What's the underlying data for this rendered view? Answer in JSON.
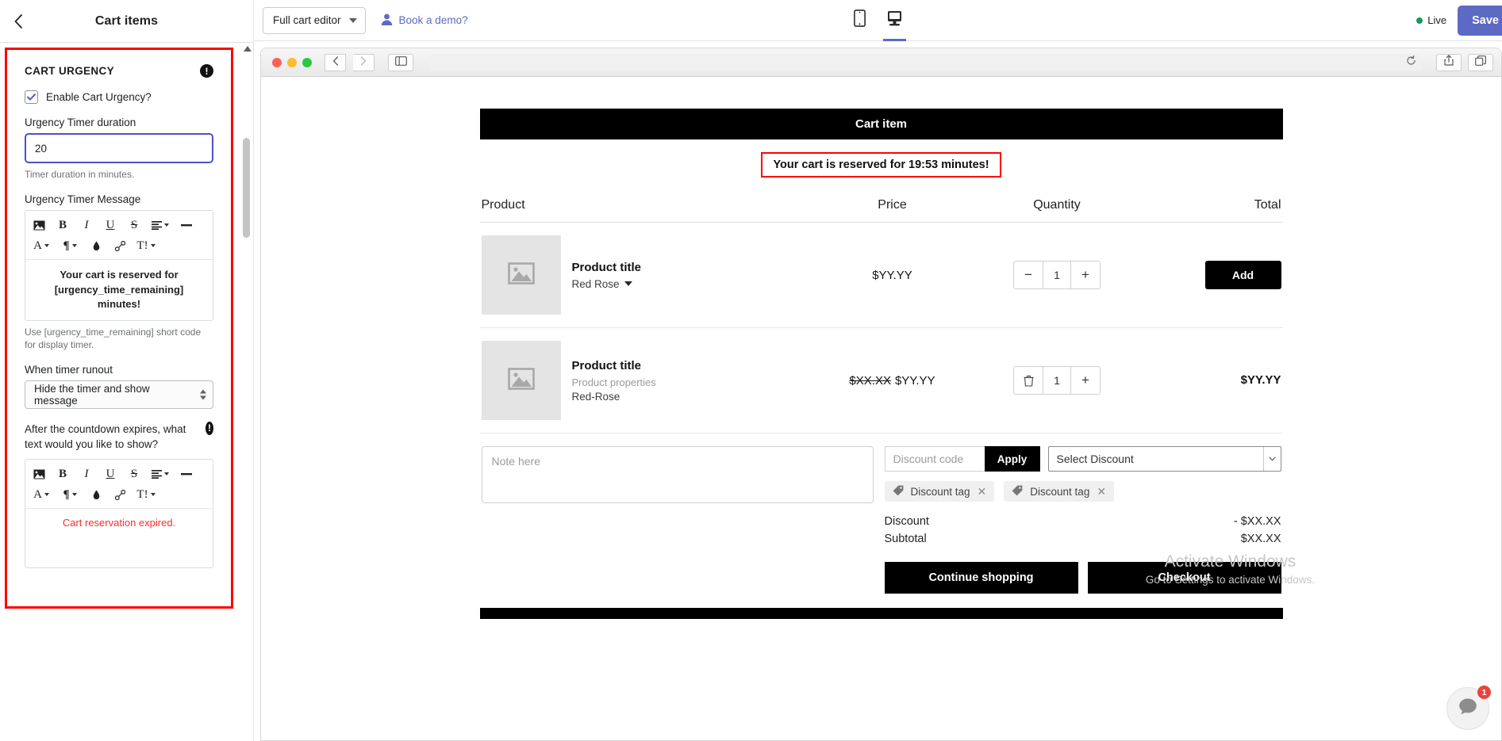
{
  "sidebar": {
    "title": "Cart items",
    "back_icon": "chevron-left-icon",
    "section": {
      "heading": "CART URGENCY",
      "info_icon": "info-exclamation-icon",
      "enable_checkbox_label": "Enable Cart Urgency?",
      "enable_checked": true,
      "duration_label": "Urgency Timer duration",
      "duration_value": "20",
      "duration_help": "Timer duration in minutes.",
      "message_label": "Urgency Timer Message",
      "message_value": "Your cart is reserved for [urgency_time_remaining] minutes!",
      "message_help": "Use [urgency_time_remaining] short code for display timer.",
      "runout_label": "When timer runout",
      "runout_value": "Hide the timer and show message",
      "expired_label": "After the countdown expires, what text would you like to show?",
      "expired_info_icon": "info-exclamation-icon",
      "expired_value": "Cart reservation expired."
    },
    "editor_toolbar": {
      "row1": [
        {
          "name": "insert-image-icon",
          "glyph": "image"
        },
        {
          "name": "bold-icon",
          "glyph": "B"
        },
        {
          "name": "italic-icon",
          "glyph": "I"
        },
        {
          "name": "underline-icon",
          "glyph": "U"
        },
        {
          "name": "strikethrough-icon",
          "glyph": "S"
        },
        {
          "name": "align-icon",
          "glyph": "align"
        },
        {
          "name": "horizontal-rule-icon",
          "glyph": "—"
        }
      ],
      "row2": [
        {
          "name": "font-family-icon",
          "glyph": "A"
        },
        {
          "name": "paragraph-format-icon",
          "glyph": "¶"
        },
        {
          "name": "text-color-icon",
          "glyph": "droplet"
        },
        {
          "name": "insert-link-icon",
          "glyph": "link"
        },
        {
          "name": "clear-formatting-icon",
          "glyph": "T!"
        }
      ]
    }
  },
  "topbar": {
    "editor_select_label": "Full cart editor",
    "demo_link_label": "Book a demo?",
    "demo_icon": "user-avatar-icon",
    "device_mobile_icon": "mobile-device-icon",
    "device_desktop_icon": "desktop-device-icon",
    "active_device": "desktop",
    "live_label": "Live",
    "live_color": "#0f9d58",
    "save_label": "Save",
    "accent_color": "#5c6ac4"
  },
  "browser_chrome": {
    "traffic_lights": [
      "close-red",
      "minimize-yellow",
      "maximize-green"
    ],
    "back_icon": "chevron-left-icon",
    "forward_icon": "chevron-right-icon",
    "sidebar_toggle_icon": "sidebar-toggle-icon",
    "url_value": "",
    "reload_icon": "reload-icon",
    "share_icon": "share-icon",
    "tabs_icon": "duplicate-tabs-icon"
  },
  "cart": {
    "header_title": "Cart item",
    "urgency_message": "Your cart is reserved for 19:53 minutes!",
    "urgency_border_color": "#ff0000",
    "columns": [
      "Product",
      "Price",
      "Quantity",
      "Total"
    ],
    "rows": [
      {
        "image_icon": "image-placeholder-icon",
        "title": "Product title",
        "variant": "Red Rose",
        "variant_caret": "caret-down-icon",
        "properties": "",
        "subtitle": "",
        "price_old": "",
        "price": "$YY.YY",
        "qty_minus_icon": "minus-icon",
        "qty": "1",
        "qty_plus_icon": "plus-icon",
        "total_type": "button",
        "total_label": "Add"
      },
      {
        "image_icon": "image-placeholder-icon",
        "title": "Product title",
        "variant": "",
        "properties": "Product properties",
        "subtitle": "Red-Rose",
        "price_old": "$XX.XX",
        "price": "$YY.YY",
        "qty_minus_icon": "trash-icon",
        "qty": "1",
        "qty_plus_icon": "plus-icon",
        "total_type": "amount",
        "total_label": "$YY.YY"
      }
    ],
    "note_placeholder": "Note here",
    "discount_placeholder": "Discount code",
    "apply_label": "Apply",
    "select_discount_label": "Select Discount",
    "select_caret_icon": "caret-down-icon",
    "discount_tags": [
      {
        "icon": "discount-tag-icon",
        "label": "Discount tag",
        "remove_icon": "close-icon"
      },
      {
        "icon": "discount-tag-icon",
        "label": "Discount tag",
        "remove_icon": "close-icon"
      }
    ],
    "totals": [
      {
        "label": "Discount",
        "value": "- $XX.XX"
      },
      {
        "label": "Subtotal",
        "value": "$XX.XX"
      }
    ],
    "continue_label": "Continue shopping",
    "checkout_label": "Checkout"
  },
  "watermark": {
    "line1": "Activate Windows",
    "line2": "Go to Settings to activate Windows."
  },
  "chat": {
    "icon": "chat-bubble-icon",
    "badge": "1",
    "badge_color": "#e8453c"
  }
}
